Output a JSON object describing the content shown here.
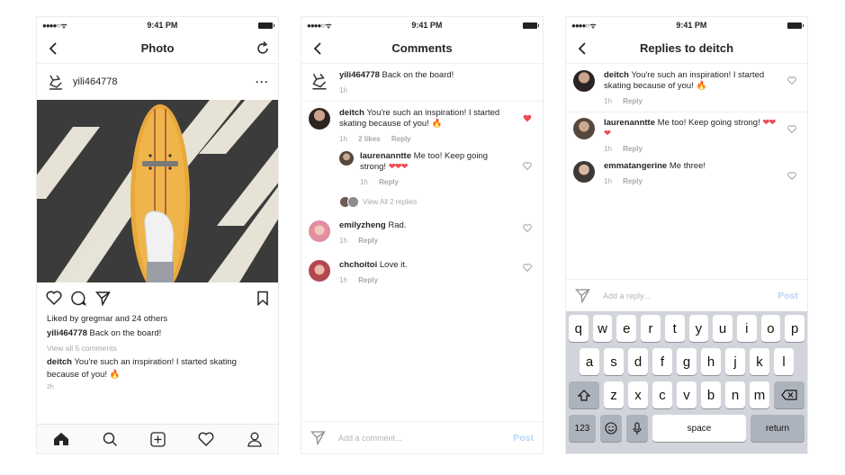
{
  "status": {
    "time": "9:41 PM"
  },
  "feed": {
    "title": "Photo",
    "username": "yili464778",
    "liked_by": "Liked by gregmar and 24 others",
    "caption_user": "yili464778",
    "caption_text": "Back on the board!",
    "view_all": "View all 5 comments",
    "comment_user": "deitch",
    "comment_text": "You're such an inspiration! I started skating because of you! 🔥",
    "age": "2h"
  },
  "comments": {
    "title": "Comments",
    "items": [
      {
        "user": "yili464778",
        "text": "Back on the board!",
        "time": "1h"
      },
      {
        "user": "deitch",
        "text": "You're such an inspiration! I started skating because of you! 🔥",
        "time": "1h",
        "likes": "2 likes",
        "reply": "Reply"
      },
      {
        "user": "laurenanntte",
        "text": "Me too! Keep going strong!",
        "hearts": "❤❤❤",
        "time": "1h",
        "reply": "Reply"
      },
      {
        "view_all": "View All 2 replies"
      },
      {
        "user": "emilyzheng",
        "text": "Rad.",
        "time": "1h",
        "reply": "Reply"
      },
      {
        "user": "chchoitoi",
        "text": "Love it.",
        "time": "1h",
        "reply": "Reply"
      }
    ],
    "placeholder": "Add a comment...",
    "post": "Post"
  },
  "replies": {
    "title": "Replies to deitch",
    "items": [
      {
        "user": "deitch",
        "text": "You're such an inspiration! I started skating because of you! 🔥",
        "time": "1h",
        "reply": "Reply"
      },
      {
        "user": "laurenanntte",
        "text": "Me too! Keep going strong!",
        "hearts": "❤❤❤",
        "time": "1h",
        "reply": "Reply"
      },
      {
        "user": "emmatangerine",
        "text": "Me three!",
        "time": "1h",
        "reply": "Reply"
      }
    ],
    "placeholder": "Add a reply...",
    "post": "Post"
  },
  "keyboard": {
    "row1": [
      "q",
      "w",
      "e",
      "r",
      "t",
      "y",
      "u",
      "i",
      "o",
      "p"
    ],
    "row2": [
      "a",
      "s",
      "d",
      "f",
      "g",
      "h",
      "j",
      "k",
      "l"
    ],
    "row3": [
      "z",
      "x",
      "c",
      "v",
      "b",
      "n",
      "m"
    ],
    "num": "123",
    "space": "space",
    "return": "return"
  },
  "colors": {
    "like_red": "#ed4956",
    "post_blue": "#b7d5f5"
  }
}
